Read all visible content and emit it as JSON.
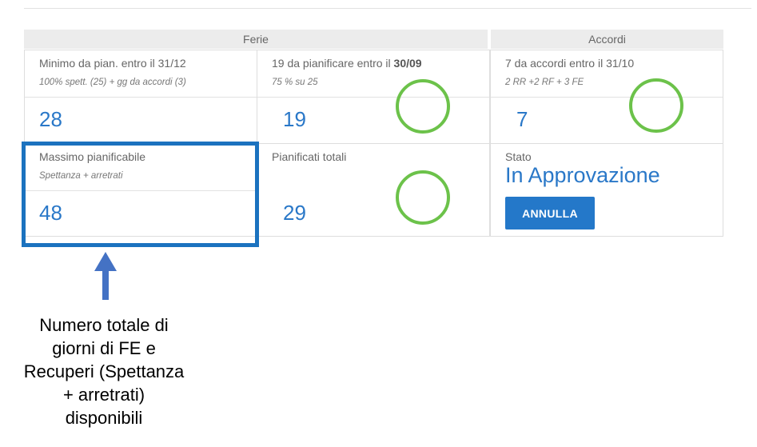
{
  "sections": {
    "ferie": "Ferie",
    "accordi": "Accordi"
  },
  "cards": {
    "minimo": {
      "title": "Minimo da pian. entro il 31/12",
      "subtitle": "100% spett. (25) + gg da accordi (3)",
      "value": "28"
    },
    "da_pianificare": {
      "title_prefix": "19 da pianificare entro il ",
      "title_bold": "30/09",
      "subtitle": "75 % su 25",
      "value": "19"
    },
    "da_accordi": {
      "title": "7 da accordi entro il 31/10",
      "subtitle": "2 RR +2 RF + 3 FE",
      "value": "7"
    },
    "massimo": {
      "title": "Massimo pianificabile",
      "subtitle": "Spettanza + arretrati",
      "value": "48"
    },
    "pianificati": {
      "title": "Pianificati totali",
      "value": "29"
    },
    "stato": {
      "title": "Stato",
      "value": "In Approvazione",
      "button": "ANNULLA"
    }
  },
  "annotation": {
    "line1": "Numero totale di",
    "line2": "giorni di FE e",
    "line3": "Recuperi (Spettanza",
    "line4": "+ arretrati)",
    "line5": "disponibili"
  },
  "colors": {
    "value_blue": "#2a78c8",
    "button_blue": "#2478c9",
    "ring_green": "#6cc24a",
    "highlight_blue": "#1b72bf"
  }
}
